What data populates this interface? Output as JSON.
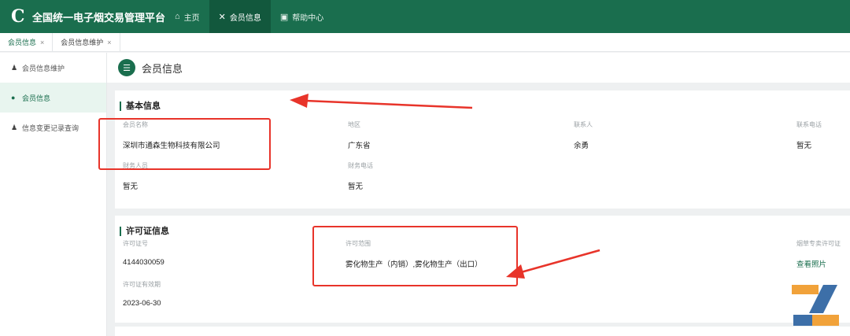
{
  "header": {
    "brand_logo": "C",
    "brand_name": "全国统一电子烟交易管理平台",
    "nav": [
      {
        "icon": "home-icon",
        "glyph": "⌂",
        "label": "主页"
      },
      {
        "icon": "member-icon",
        "glyph": "✕",
        "label": "会员信息"
      },
      {
        "icon": "help-icon",
        "glyph": "▣",
        "label": "帮助中心"
      }
    ]
  },
  "tabs": [
    {
      "label": "会员信息",
      "close": "×"
    },
    {
      "label": "会员信息维护",
      "close": "×"
    }
  ],
  "sidebar": {
    "items": [
      {
        "icon": "user-icon",
        "glyph": "♟",
        "label": "会员信息维护"
      },
      {
        "icon": "member-circle-icon",
        "glyph": "●",
        "label": "会员信息"
      },
      {
        "icon": "user-icon",
        "glyph": "♟",
        "label": "信息变更记录查询"
      }
    ]
  },
  "page": {
    "title": "会员信息",
    "icon_glyph": "☰"
  },
  "basic": {
    "title": "基本信息",
    "company_label": "会员名称",
    "company_value": "深圳市通森生物科技有限公司",
    "region_label": "地区",
    "region_value": "广东省",
    "contact_label": "联系人",
    "contact_value": "余勇",
    "phone_label": "联系电话",
    "phone_value": "暂无",
    "finance_label": "财务人员",
    "finance_value": "暂无",
    "finance_phone_label": "财务电话",
    "finance_phone_value": "暂无"
  },
  "license": {
    "title": "许可证信息",
    "no_label": "许可证号",
    "no_value": "4144030059",
    "scope_label": "许可范围",
    "scope_value": "雾化物生产（内销）,雾化物生产（出口）",
    "cert_label": "烟草专卖许可证",
    "cert_link": "查看照片",
    "expiry_label": "许可证有效期",
    "expiry_value": "2023-06-30"
  },
  "colors": {
    "brand": "#1a6e4e",
    "annotation": "#e8342a"
  }
}
